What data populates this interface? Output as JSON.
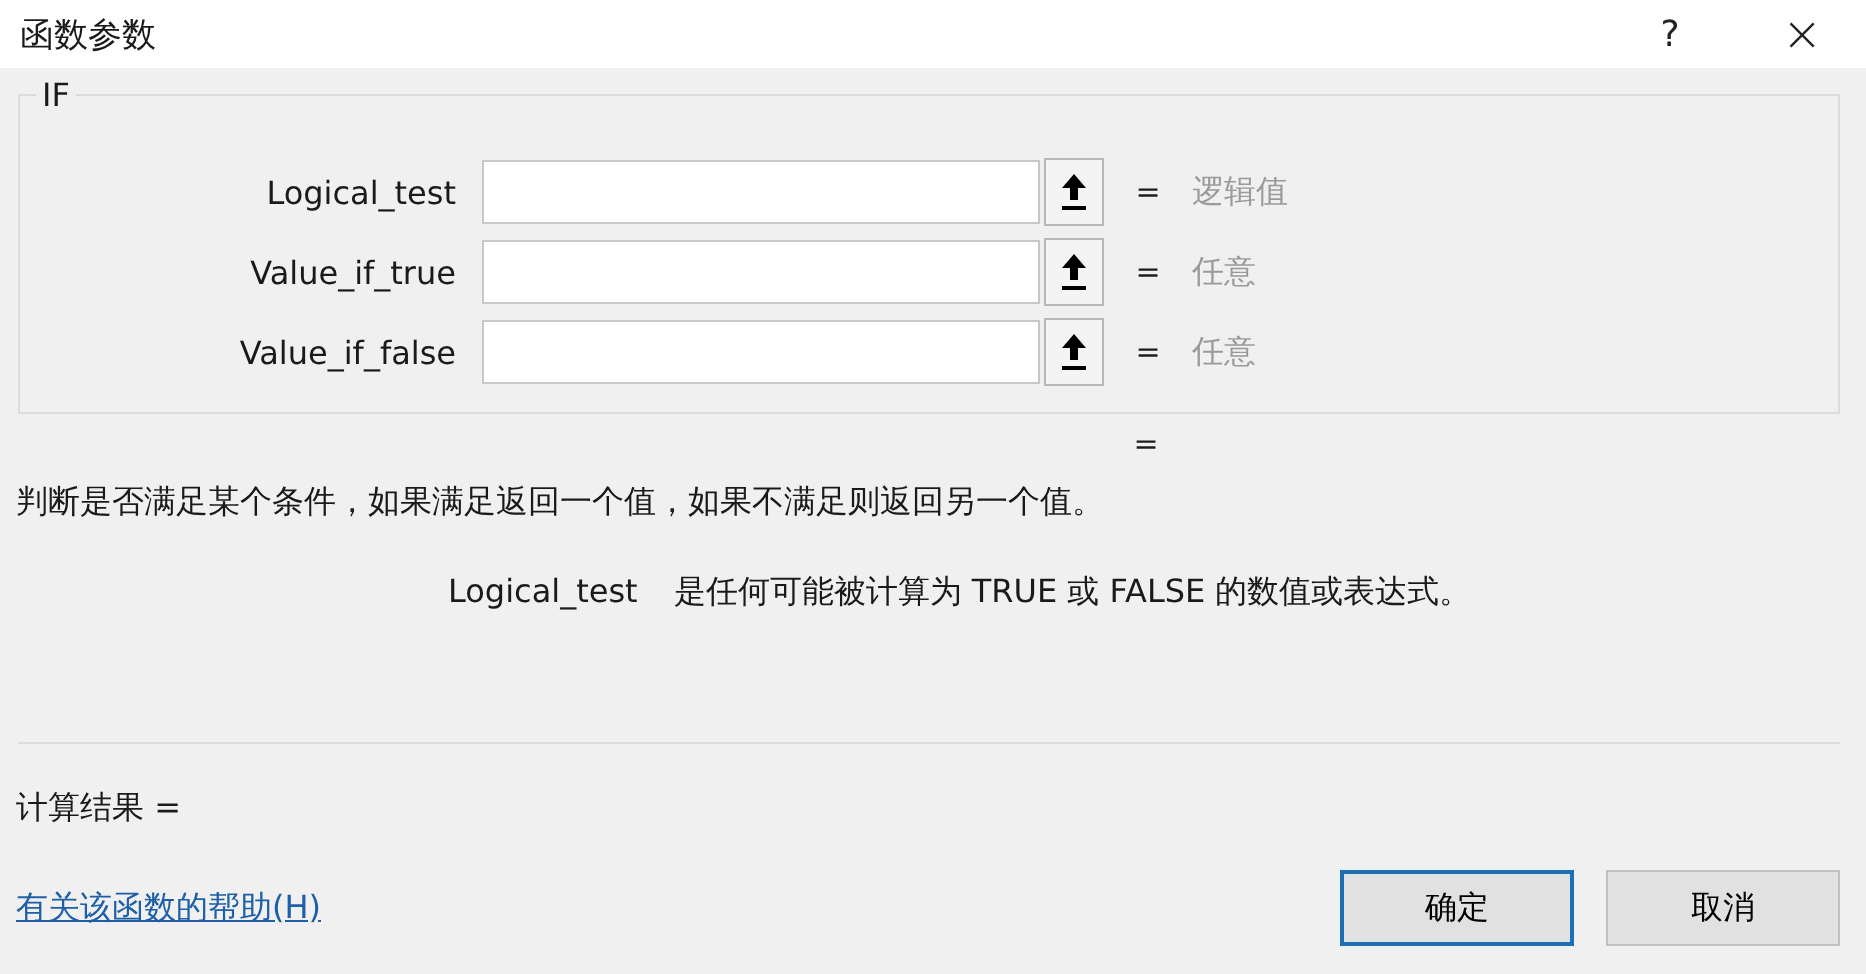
{
  "window": {
    "title": "函数参数",
    "help": "?",
    "close": "×"
  },
  "function": {
    "name": "IF",
    "arguments": [
      {
        "label": "Logical_test",
        "equals": "=",
        "result": "逻辑值"
      },
      {
        "label": "Value_if_true",
        "equals": "=",
        "result": "任意"
      },
      {
        "label": "Value_if_false",
        "equals": "=",
        "result": "任意"
      }
    ],
    "result_equals": "="
  },
  "description": "判断是否满足某个条件，如果满足返回一个值，如果不满足则返回另一个值。",
  "argument_help": {
    "name": "Logical_test",
    "text": "是任何可能被计算为 TRUE 或 FALSE 的数值或表达式。"
  },
  "formula_result": "计算结果 =",
  "help_link": "有关该函数的帮助(H)",
  "buttons": [
    {
      "label": "确定",
      "default": true
    },
    {
      "label": "取消",
      "default": false
    }
  ]
}
